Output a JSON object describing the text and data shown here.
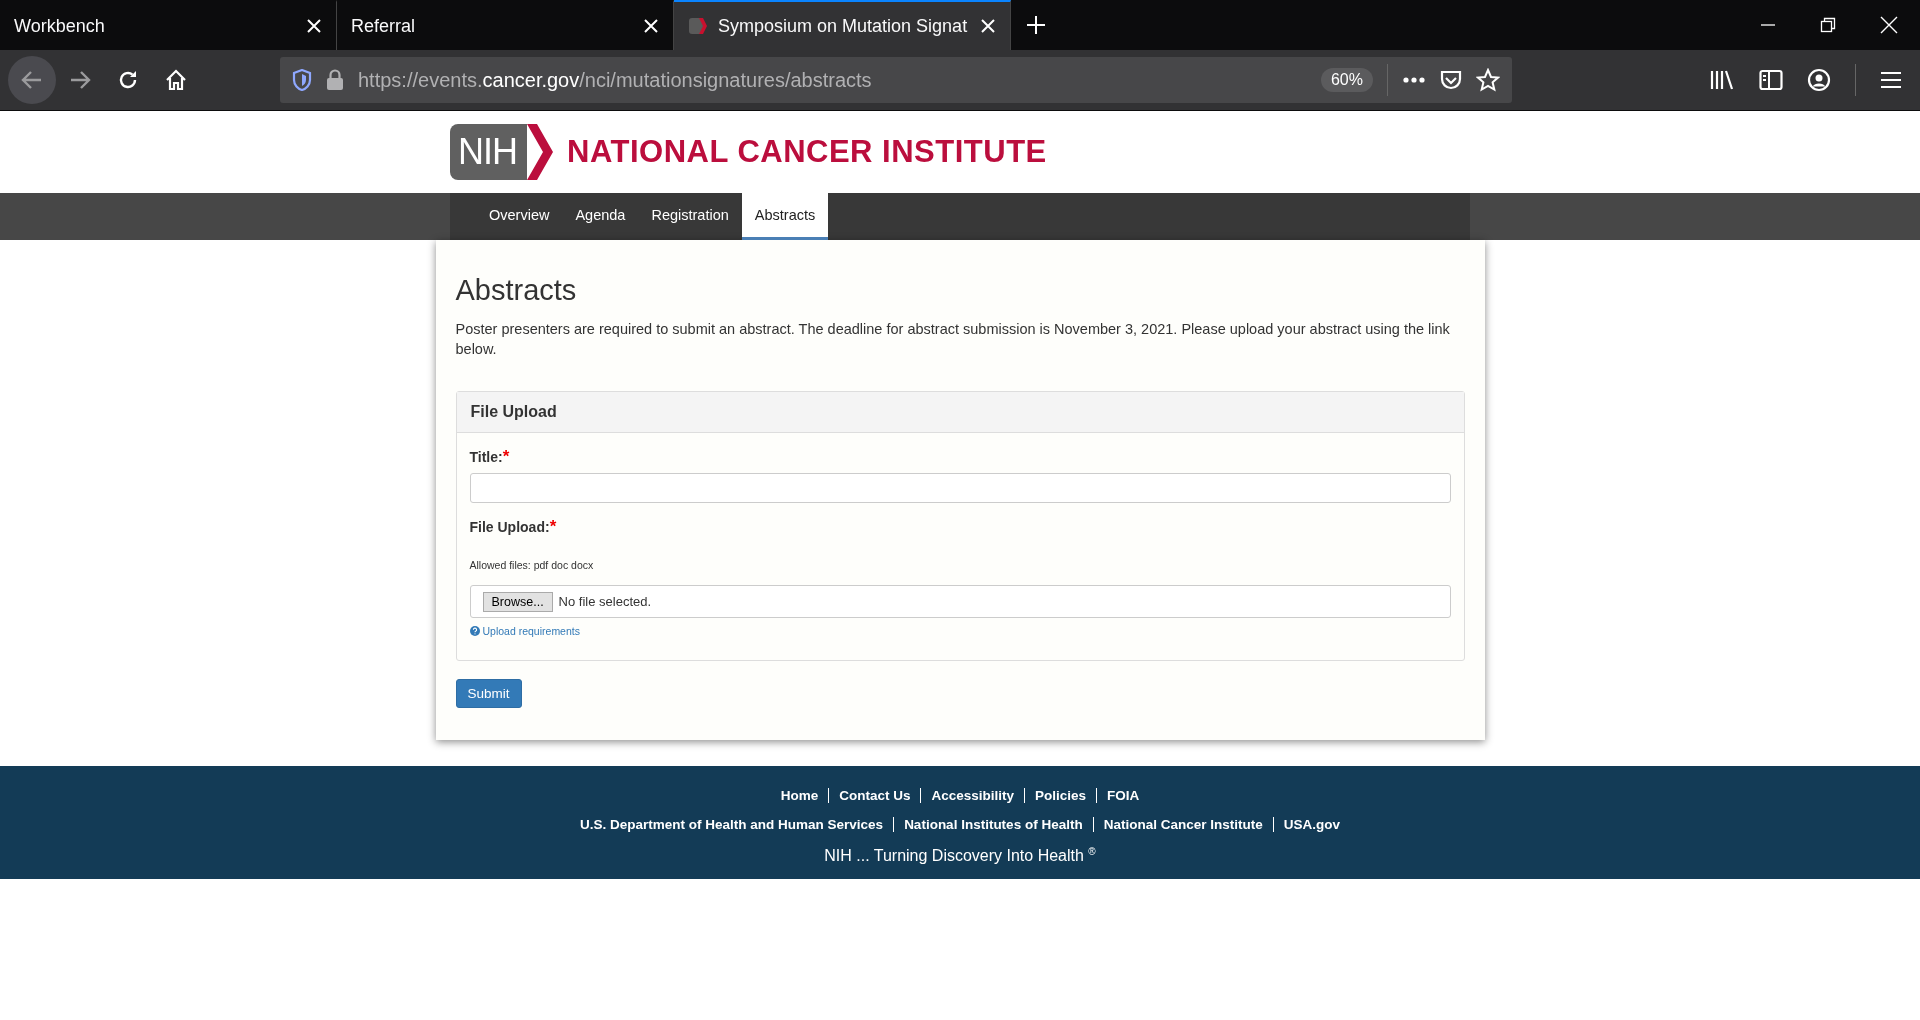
{
  "browser": {
    "tabs": [
      {
        "title": "Workbench",
        "selected": false,
        "favicon": false
      },
      {
        "title": "Referral",
        "selected": false,
        "favicon": false
      },
      {
        "title": "Symposium on Mutation Signat",
        "selected": true,
        "favicon": true
      }
    ],
    "url": {
      "prefix": "https://events.",
      "domain": "cancer.gov",
      "path": "/nci/mutationsignatures/abstracts"
    },
    "zoom": "60%"
  },
  "header": {
    "logo_text": "NIH",
    "title": "NATIONAL CANCER INSTITUTE"
  },
  "nav": [
    {
      "label": "Overview",
      "selected": false
    },
    {
      "label": "Agenda",
      "selected": false
    },
    {
      "label": "Registration",
      "selected": false
    },
    {
      "label": "Abstracts",
      "selected": true
    }
  ],
  "content": {
    "heading": "Abstracts",
    "intro": "Poster presenters are required to submit an abstract. The deadline for abstract submission is November 3, 2021. Please upload your abstract using the link below.",
    "panel": {
      "title": "File Upload",
      "fields": [
        {
          "kind": "text",
          "label": "Title:",
          "required_mark": "*"
        },
        {
          "kind": "file",
          "label": "File Upload:",
          "required_mark": "*",
          "hint": "Allowed files: pdf doc docx",
          "button": "Browse...",
          "status": "No file selected.",
          "help_link": "Upload requirements"
        }
      ]
    },
    "submit": "Submit"
  },
  "footer": {
    "links_1": [
      "Home",
      "Contact Us",
      "Accessibility",
      "Policies",
      "FOIA"
    ],
    "links_2": [
      "U.S. Department of Health and Human Services",
      "National Institutes of Health",
      "National Cancer Institute",
      "USA.gov"
    ],
    "tagline": "NIH ... Turning Discovery Into Health $^{®}$"
  }
}
